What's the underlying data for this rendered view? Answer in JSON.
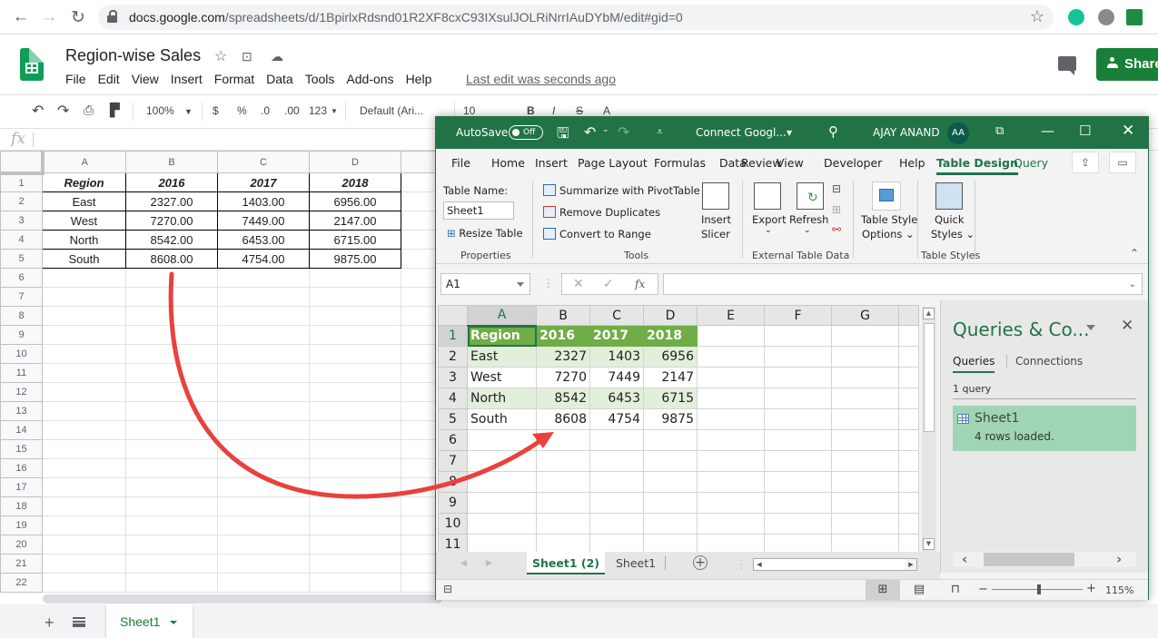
{
  "browser": {
    "url_host": "docs.google.com",
    "url_path": "/spreadsheets/d/1BpirlxRdsnd01R2XF8cxC93IXsulJOLRiNrrIAuDYbM/edit#gid=0",
    "nav": {
      "back": "←",
      "forward": "→",
      "reload": "↻"
    },
    "star": "☆"
  },
  "gsheets": {
    "title": "Region-wise Sales",
    "menu": [
      "File",
      "Edit",
      "View",
      "Insert",
      "Format",
      "Data",
      "Tools",
      "Add-ons",
      "Help"
    ],
    "last_edit": "Last edit was seconds ago",
    "share_label": "Share",
    "toolbar": {
      "zoom": "100%",
      "currency": "$",
      "percent": "%",
      "dec_less": ".0",
      "dec_more": ".00",
      "format_more": "123",
      "font": "Default (Ari...",
      "font_size": "10"
    },
    "fx_label": "fx",
    "columns": [
      "A",
      "B",
      "C",
      "D",
      ""
    ],
    "row_numbers": [
      "1",
      "2",
      "3",
      "4",
      "5",
      "6",
      "7",
      "8",
      "9",
      "10",
      "11",
      "12",
      "13",
      "14",
      "15",
      "16",
      "17",
      "18",
      "19",
      "20",
      "21",
      "22"
    ],
    "table": {
      "headers": [
        "Region",
        "2016",
        "2017",
        "2018"
      ],
      "rows": [
        [
          "East",
          "2327.00",
          "1403.00",
          "6956.00"
        ],
        [
          "West",
          "7270.00",
          "7449.00",
          "2147.00"
        ],
        [
          "North",
          "8542.00",
          "6453.00",
          "6715.00"
        ],
        [
          "South",
          "8608.00",
          "4754.00",
          "9875.00"
        ]
      ]
    },
    "sheet_tab": "Sheet1",
    "add_sheet": "+"
  },
  "excel": {
    "autosave_label": "AutoSave",
    "autosave_state": "Off",
    "doc_title": "Connect Googl...",
    "user_name": "AJAY ANAND",
    "user_initials": "AA",
    "tabs": [
      "File",
      "Home",
      "Insert",
      "Page Layout",
      "Formulas",
      "Data",
      "Review",
      "View",
      "Developer",
      "Help",
      "Table Design",
      "Query"
    ],
    "active_tab": "Table Design",
    "ribbon": {
      "table_name_label": "Table Name:",
      "table_name_value": "Sheet1",
      "resize_table": "Resize Table",
      "properties_group": "Properties",
      "summarize_pivot": "Summarize with PivotTable",
      "remove_duplicates": "Remove Duplicates",
      "convert_range": "Convert to Range",
      "insert_slicer_1": "Insert",
      "insert_slicer_2": "Slicer",
      "tools_group": "Tools",
      "export": "Export",
      "refresh": "Refresh",
      "external_group": "External Table Data",
      "style_options_1": "Table Style",
      "style_options_2": "Options",
      "quick_styles_1": "Quick",
      "quick_styles_2": "Styles",
      "styles_group": "Table Styles"
    },
    "name_box": "A1",
    "formula_value": "",
    "columns": [
      "A",
      "B",
      "C",
      "D",
      "E",
      "F",
      "G"
    ],
    "row_numbers": [
      "1",
      "2",
      "3",
      "4",
      "5",
      "6",
      "7",
      "8",
      "9",
      "10",
      "11"
    ],
    "table": {
      "headers": [
        "Region",
        "2016",
        "2017",
        "2018"
      ],
      "rows": [
        [
          "East",
          "2327",
          "1403",
          "6956"
        ],
        [
          "West",
          "7270",
          "7449",
          "2147"
        ],
        [
          "North",
          "8542",
          "6453",
          "6715"
        ],
        [
          "South",
          "8608",
          "4754",
          "9875"
        ]
      ]
    },
    "queries_pane": {
      "title": "Queries & Co...",
      "tab_queries": "Queries",
      "tab_connections": "Connections",
      "count": "1 query",
      "items": [
        {
          "name": "Sheet1",
          "status": "4 rows loaded."
        }
      ]
    },
    "sheet_tabs": [
      "Sheet1 (2)",
      "Sheet1"
    ],
    "active_sheet": "Sheet1 (2)",
    "zoom": "115%",
    "accent": "#217346",
    "table_header_color": "#70ad47",
    "table_band_color": "#e2efda"
  },
  "annotation": {
    "arrow_color": "#e8413e"
  }
}
